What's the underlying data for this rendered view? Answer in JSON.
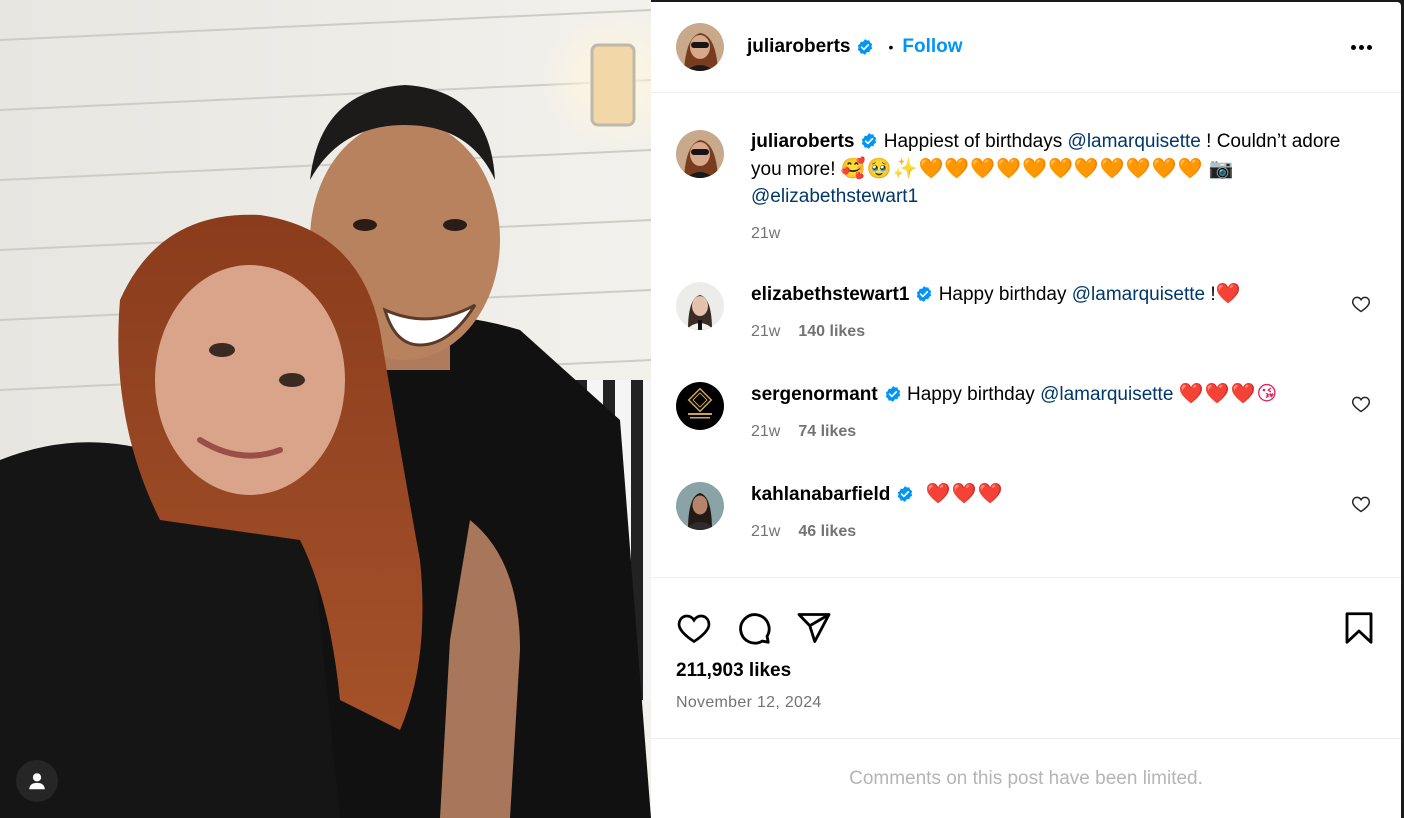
{
  "post": {
    "author": "juliaroberts",
    "verified": true,
    "follow_label": "Follow",
    "dot": "•",
    "caption_prefix": "Happiest of birthdays ",
    "caption_mention_1": "@lamarquisette",
    "caption_mid": " ! Couldn’t adore you more! ",
    "caption_emojis": "🥰🥹✨",
    "caption_hearts": "🧡🧡🧡🧡🧡🧡🧡🧡🧡🧡🧡",
    "caption_camera": "📷",
    "caption_mention_2": "@elizabethstewart1",
    "caption_time": "21w",
    "likes": "211,903 likes",
    "date": "November 12, 2024",
    "comments_limited": "Comments on this post have been limited."
  },
  "comments": [
    {
      "user": "elizabethstewart1",
      "text": "Happy birthday ",
      "mention": "@lamarquisette",
      "suffix": " !",
      "emoji": "❤️",
      "time": "21w",
      "likes": "140 likes"
    },
    {
      "user": "sergenormant",
      "text": "Happy birthday ",
      "mention": "@lamarquisette",
      "suffix": " ",
      "emoji": "❤️❤️❤️😘",
      "time": "21w",
      "likes": "74 likes"
    },
    {
      "user": "kahlanabarfield",
      "text": "",
      "mention": "",
      "suffix": "",
      "emoji": "❤️❤️❤️",
      "time": "21w",
      "likes": "46 likes"
    }
  ],
  "icons": {
    "verified": "verified-badge-icon",
    "more": "more-options-icon",
    "like": "heart-icon",
    "comment": "comment-icon",
    "share": "share-icon",
    "save": "bookmark-icon",
    "user_tag": "user-tag-icon"
  },
  "colors": {
    "follow": "#0095f6",
    "mention": "#00376b",
    "verified": "#0095f6",
    "muted": "#737373"
  }
}
